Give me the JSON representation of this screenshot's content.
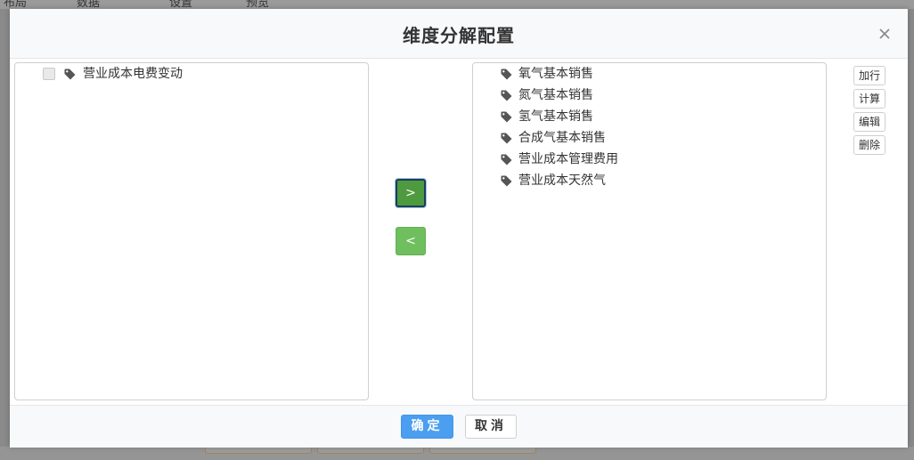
{
  "background": {
    "top_tabs": [
      "布局",
      "数据",
      "设置",
      "预览"
    ]
  },
  "modal": {
    "title": "维度分解配置",
    "left_items": [
      {
        "label": "营业成本电费变动",
        "checked": false
      }
    ],
    "right_items": [
      {
        "label": "氧气基本销售"
      },
      {
        "label": "氮气基本销售"
      },
      {
        "label": "氢气基本销售"
      },
      {
        "label": "合成气基本销售"
      },
      {
        "label": "营业成本管理费用"
      },
      {
        "label": "营业成本天然气"
      }
    ],
    "move_right_label": ">",
    "move_left_label": "<",
    "side_buttons": {
      "add_row": "加行",
      "calculate": "计算",
      "edit": "编辑",
      "delete": "删除"
    },
    "ok_label": "确定",
    "cancel_label": "取消"
  },
  "colors": {
    "primary": "#4b9ef0",
    "move_active": "#4e9a3e",
    "move_normal": "#6fbf5f",
    "tag_icon": "#555555"
  },
  "icons": {
    "close": "close-icon",
    "tag": "tag-icon"
  }
}
